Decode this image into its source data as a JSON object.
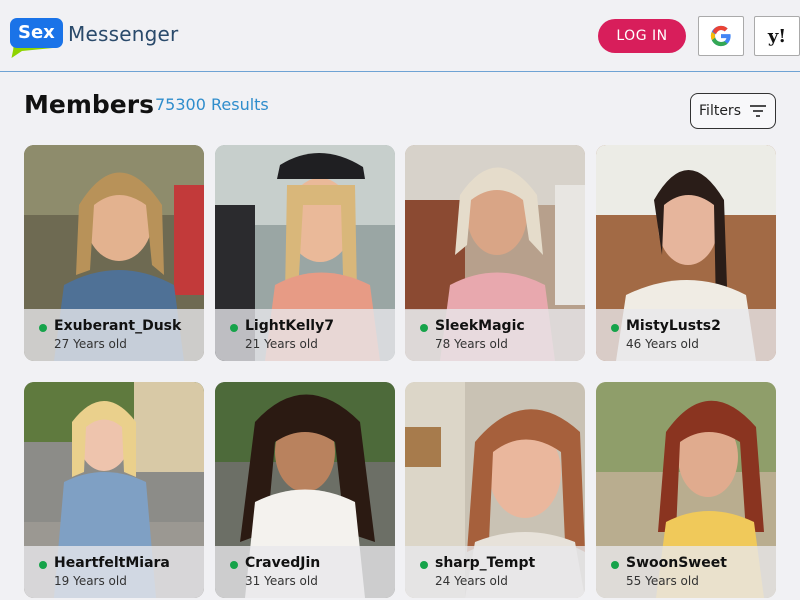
{
  "header": {
    "logo_badge": "Sex",
    "logo_text": "Messenger",
    "login_label": "LOG IN",
    "yahoo_label": "y!"
  },
  "main": {
    "title": "Members",
    "results": "75300 Results",
    "filters_label": "Filters"
  },
  "members": [
    {
      "name": "Exuberant_Dusk",
      "age": "27 Years old"
    },
    {
      "name": "LightKelly7",
      "age": "21 Years old"
    },
    {
      "name": "SleekMagic",
      "age": "78 Years old"
    },
    {
      "name": "MistyLusts2",
      "age": "46 Years old"
    },
    {
      "name": "HeartfeltMiara",
      "age": "19 Years old"
    },
    {
      "name": "CravedJin",
      "age": "31 Years old"
    },
    {
      "name": "sharp_Tempt",
      "age": "24 Years old"
    },
    {
      "name": "SwoonSweet",
      "age": "55 Years old"
    }
  ],
  "colors": {
    "login": "#d81e5b",
    "accent": "#2f8dcc",
    "online": "#16a34a"
  }
}
